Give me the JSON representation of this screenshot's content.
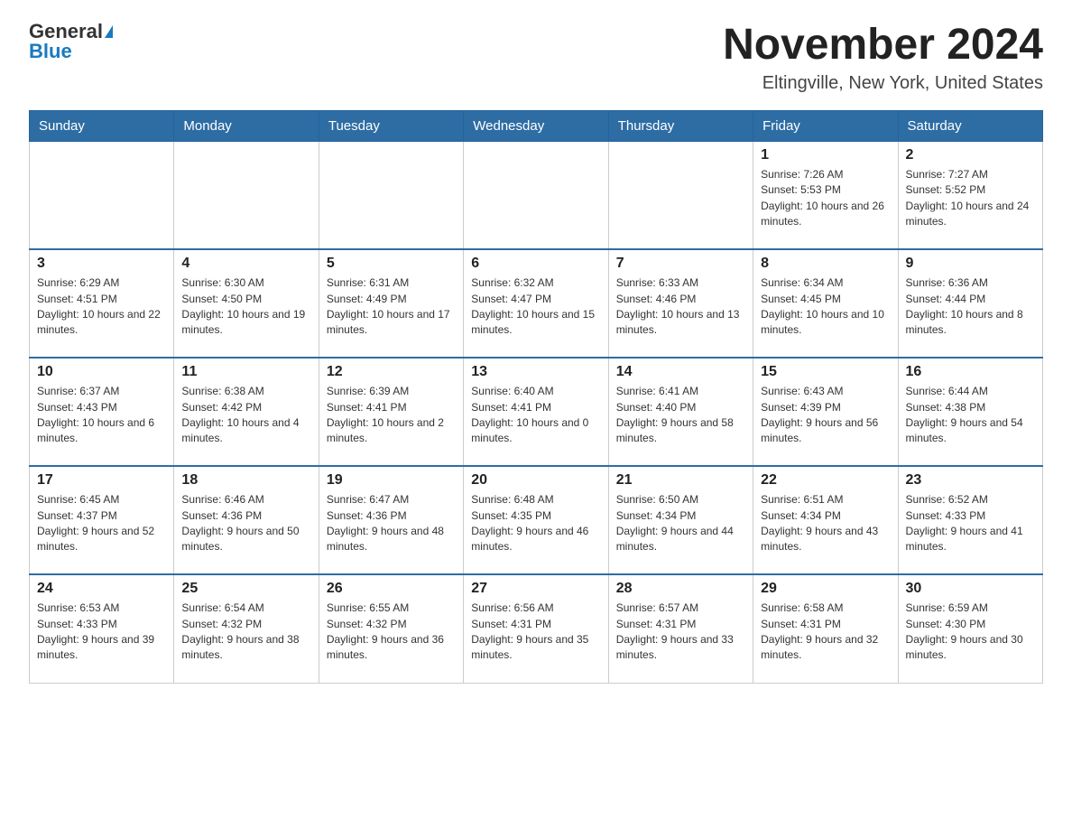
{
  "header": {
    "logo_general": "General",
    "logo_blue": "Blue",
    "month": "November 2024",
    "location": "Eltingville, New York, United States"
  },
  "weekdays": [
    "Sunday",
    "Monday",
    "Tuesday",
    "Wednesday",
    "Thursday",
    "Friday",
    "Saturday"
  ],
  "weeks": [
    [
      {
        "day": "",
        "info": ""
      },
      {
        "day": "",
        "info": ""
      },
      {
        "day": "",
        "info": ""
      },
      {
        "day": "",
        "info": ""
      },
      {
        "day": "",
        "info": ""
      },
      {
        "day": "1",
        "info": "Sunrise: 7:26 AM\nSunset: 5:53 PM\nDaylight: 10 hours and 26 minutes."
      },
      {
        "day": "2",
        "info": "Sunrise: 7:27 AM\nSunset: 5:52 PM\nDaylight: 10 hours and 24 minutes."
      }
    ],
    [
      {
        "day": "3",
        "info": "Sunrise: 6:29 AM\nSunset: 4:51 PM\nDaylight: 10 hours and 22 minutes."
      },
      {
        "day": "4",
        "info": "Sunrise: 6:30 AM\nSunset: 4:50 PM\nDaylight: 10 hours and 19 minutes."
      },
      {
        "day": "5",
        "info": "Sunrise: 6:31 AM\nSunset: 4:49 PM\nDaylight: 10 hours and 17 minutes."
      },
      {
        "day": "6",
        "info": "Sunrise: 6:32 AM\nSunset: 4:47 PM\nDaylight: 10 hours and 15 minutes."
      },
      {
        "day": "7",
        "info": "Sunrise: 6:33 AM\nSunset: 4:46 PM\nDaylight: 10 hours and 13 minutes."
      },
      {
        "day": "8",
        "info": "Sunrise: 6:34 AM\nSunset: 4:45 PM\nDaylight: 10 hours and 10 minutes."
      },
      {
        "day": "9",
        "info": "Sunrise: 6:36 AM\nSunset: 4:44 PM\nDaylight: 10 hours and 8 minutes."
      }
    ],
    [
      {
        "day": "10",
        "info": "Sunrise: 6:37 AM\nSunset: 4:43 PM\nDaylight: 10 hours and 6 minutes."
      },
      {
        "day": "11",
        "info": "Sunrise: 6:38 AM\nSunset: 4:42 PM\nDaylight: 10 hours and 4 minutes."
      },
      {
        "day": "12",
        "info": "Sunrise: 6:39 AM\nSunset: 4:41 PM\nDaylight: 10 hours and 2 minutes."
      },
      {
        "day": "13",
        "info": "Sunrise: 6:40 AM\nSunset: 4:41 PM\nDaylight: 10 hours and 0 minutes."
      },
      {
        "day": "14",
        "info": "Sunrise: 6:41 AM\nSunset: 4:40 PM\nDaylight: 9 hours and 58 minutes."
      },
      {
        "day": "15",
        "info": "Sunrise: 6:43 AM\nSunset: 4:39 PM\nDaylight: 9 hours and 56 minutes."
      },
      {
        "day": "16",
        "info": "Sunrise: 6:44 AM\nSunset: 4:38 PM\nDaylight: 9 hours and 54 minutes."
      }
    ],
    [
      {
        "day": "17",
        "info": "Sunrise: 6:45 AM\nSunset: 4:37 PM\nDaylight: 9 hours and 52 minutes."
      },
      {
        "day": "18",
        "info": "Sunrise: 6:46 AM\nSunset: 4:36 PM\nDaylight: 9 hours and 50 minutes."
      },
      {
        "day": "19",
        "info": "Sunrise: 6:47 AM\nSunset: 4:36 PM\nDaylight: 9 hours and 48 minutes."
      },
      {
        "day": "20",
        "info": "Sunrise: 6:48 AM\nSunset: 4:35 PM\nDaylight: 9 hours and 46 minutes."
      },
      {
        "day": "21",
        "info": "Sunrise: 6:50 AM\nSunset: 4:34 PM\nDaylight: 9 hours and 44 minutes."
      },
      {
        "day": "22",
        "info": "Sunrise: 6:51 AM\nSunset: 4:34 PM\nDaylight: 9 hours and 43 minutes."
      },
      {
        "day": "23",
        "info": "Sunrise: 6:52 AM\nSunset: 4:33 PM\nDaylight: 9 hours and 41 minutes."
      }
    ],
    [
      {
        "day": "24",
        "info": "Sunrise: 6:53 AM\nSunset: 4:33 PM\nDaylight: 9 hours and 39 minutes."
      },
      {
        "day": "25",
        "info": "Sunrise: 6:54 AM\nSunset: 4:32 PM\nDaylight: 9 hours and 38 minutes."
      },
      {
        "day": "26",
        "info": "Sunrise: 6:55 AM\nSunset: 4:32 PM\nDaylight: 9 hours and 36 minutes."
      },
      {
        "day": "27",
        "info": "Sunrise: 6:56 AM\nSunset: 4:31 PM\nDaylight: 9 hours and 35 minutes."
      },
      {
        "day": "28",
        "info": "Sunrise: 6:57 AM\nSunset: 4:31 PM\nDaylight: 9 hours and 33 minutes."
      },
      {
        "day": "29",
        "info": "Sunrise: 6:58 AM\nSunset: 4:31 PM\nDaylight: 9 hours and 32 minutes."
      },
      {
        "day": "30",
        "info": "Sunrise: 6:59 AM\nSunset: 4:30 PM\nDaylight: 9 hours and 30 minutes."
      }
    ]
  ]
}
